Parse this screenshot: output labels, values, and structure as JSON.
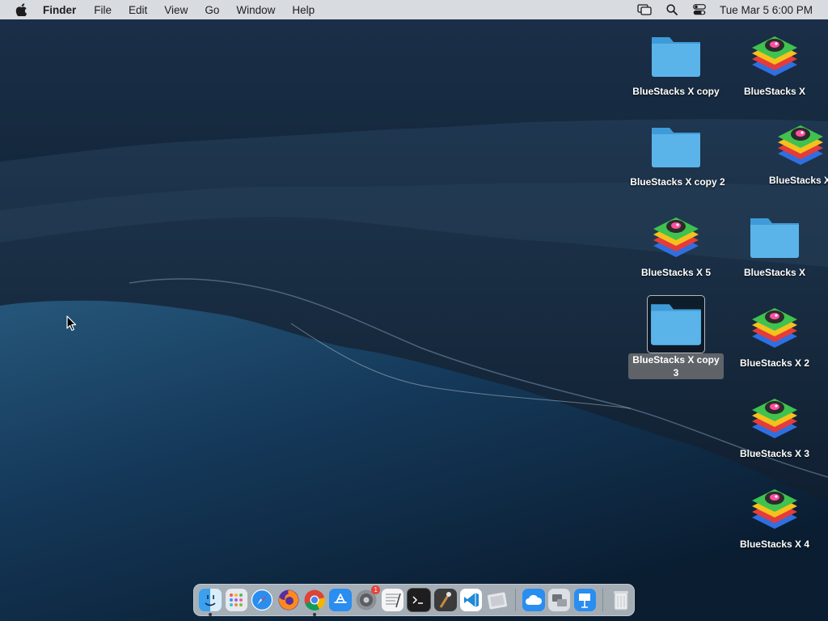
{
  "menubar": {
    "app_name": "Finder",
    "menus": [
      "File",
      "Edit",
      "View",
      "Go",
      "Window",
      "Help"
    ],
    "clock": "Tue Mar 5  6:00 PM",
    "status_icons": [
      "screen-mirroring-icon",
      "spotlight-search-icon",
      "control-center-icon"
    ]
  },
  "desktop": {
    "icons": [
      {
        "label": "BlueStacks X copy",
        "kind": "folder"
      },
      {
        "label": "BlueStacks X",
        "kind": "app"
      },
      {
        "label": "BlueStacks X copy 2",
        "kind": "folder"
      },
      {
        "label": "BlueStacks X",
        "kind": "app"
      },
      {
        "label": "BlueStacks X 5",
        "kind": "app"
      },
      {
        "label": "BlueStacks X",
        "kind": "folder"
      },
      {
        "label": "BlueStacks X copy 3",
        "kind": "folder",
        "selected": true
      },
      {
        "label": "BlueStacks X 2",
        "kind": "app"
      },
      {
        "label": "BlueStacks X 3",
        "kind": "app"
      },
      {
        "label": "BlueStacks X 4",
        "kind": "app"
      }
    ]
  },
  "dock": {
    "apps": [
      "finder-icon",
      "launchpad-icon",
      "safari-icon",
      "firefox-icon",
      "chrome-icon",
      "app-store-icon",
      "system-settings-icon",
      "textedit-icon",
      "terminal-icon",
      "instruments-icon",
      "vscode-icon",
      "preview-icon",
      "icloud-icon",
      "migration-assistant-icon",
      "keynote-icon",
      "trash-icon"
    ],
    "settings_badge": "1"
  },
  "colors": {
    "folder": "#5ab4ea",
    "menubar": "#e8eaee"
  }
}
